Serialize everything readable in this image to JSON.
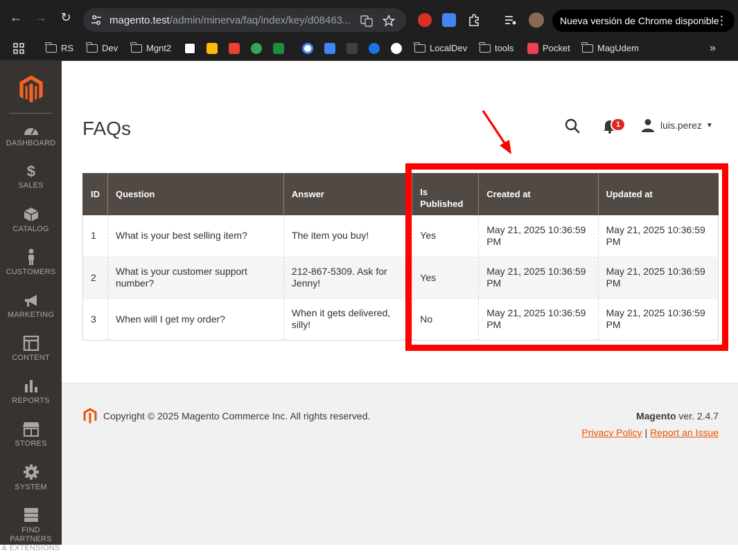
{
  "browser": {
    "url_host": "magento.test",
    "url_path": "/admin/minerva/faq/index/key/d08463...",
    "update_label": "Nueva versión de Chrome disponible",
    "bookmarks": [
      "RS",
      "Dev",
      "Mgnt2",
      "LocalDev",
      "tools",
      "Pocket",
      "MagUdem"
    ]
  },
  "sidebar": {
    "items": [
      {
        "label": "DASHBOARD",
        "icon": "dashboard-icon"
      },
      {
        "label": "SALES",
        "icon": "dollar-icon"
      },
      {
        "label": "CATALOG",
        "icon": "box-icon"
      },
      {
        "label": "CUSTOMERS",
        "icon": "person-icon"
      },
      {
        "label": "MARKETING",
        "icon": "megaphone-icon"
      },
      {
        "label": "CONTENT",
        "icon": "layout-icon"
      },
      {
        "label": "REPORTS",
        "icon": "bar-chart-icon"
      },
      {
        "label": "STORES",
        "icon": "store-icon"
      },
      {
        "label": "SYSTEM",
        "icon": "gear-icon"
      },
      {
        "label": "FIND PARTNERS",
        "label2": "& EXTENSIONS",
        "icon": "blocks-icon"
      }
    ]
  },
  "header": {
    "title": "FAQs",
    "notification_count": "1",
    "username": "luis.perez"
  },
  "grid": {
    "columns": {
      "id": "ID",
      "question": "Question",
      "answer": "Answer",
      "is_published_1": "Is",
      "is_published_2": "Published",
      "created_at": "Created at",
      "updated_at": "Updated at"
    },
    "rows": [
      {
        "id": "1",
        "question": "What is your best selling item?",
        "answer": "The item you buy!",
        "published": "Yes",
        "created": "May 21, 2025 10:36:59 PM",
        "updated": "May 21, 2025 10:36:59 PM"
      },
      {
        "id": "2",
        "question": "What is your customer support number?",
        "answer": "212-867-5309. Ask for Jenny!",
        "published": "Yes",
        "created": "May 21, 2025 10:36:59 PM",
        "updated": "May 21, 2025 10:36:59 PM"
      },
      {
        "id": "3",
        "question": "When will I get my order?",
        "answer": "When it gets delivered, silly!",
        "published": "No",
        "created": "May 21, 2025 10:36:59 PM",
        "updated": "May 21, 2025 10:36:59 PM"
      }
    ]
  },
  "footer": {
    "copyright": "Copyright © 2025 Magento Commerce Inc. All rights reserved.",
    "brand": "Magento",
    "version": " ver. 2.4.7",
    "privacy": "Privacy Policy",
    "separator": "|",
    "report": "Report an Issue"
  },
  "colors": {
    "sidebar_bg": "#373330",
    "grid_header": "#514943",
    "brand_orange": "#eb5202",
    "annotation": "#ff0000"
  }
}
